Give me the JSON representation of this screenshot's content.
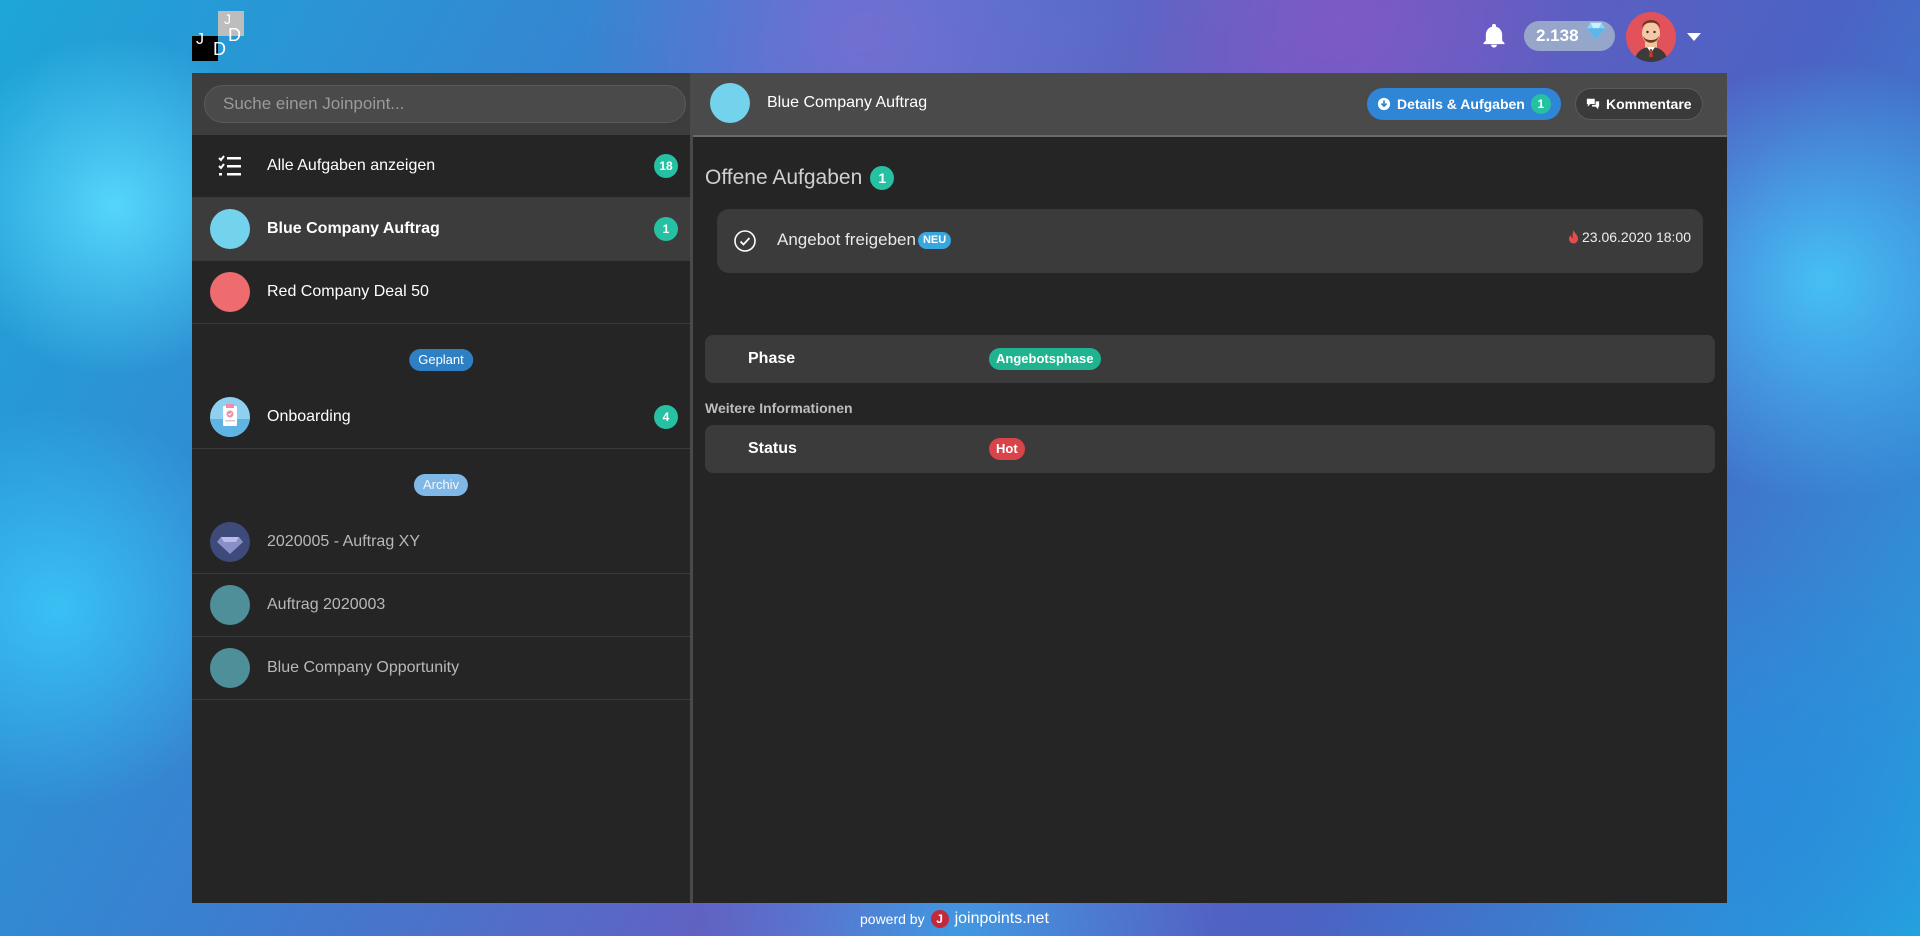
{
  "logo": {
    "letters": [
      "J",
      "D",
      "J",
      "D"
    ]
  },
  "topbar": {
    "points": "2.138",
    "icons": {
      "bell": "bell-icon",
      "points": "diamond-icon",
      "menu": "chevron-down-icon"
    }
  },
  "sidebar": {
    "search_placeholder": "Suche einen Joinpoint...",
    "all_tasks": {
      "label": "Alle Aufgaben anzeigen",
      "count": "18"
    },
    "active": [
      {
        "label": "Blue Company Auftrag",
        "count": "1",
        "color": "#74d3ec"
      },
      {
        "label": "Red Company Deal 50",
        "count": "",
        "color": "#ee6b6f"
      }
    ],
    "planned_label": "Geplant",
    "planned": [
      {
        "label": "Onboarding",
        "count": "4"
      }
    ],
    "archive_label": "Archiv",
    "archived": [
      {
        "label": "2020005 - Auftrag XY",
        "color": "#4a5a8a"
      },
      {
        "label": "Auftrag 2020003",
        "color": "#4f8f99"
      },
      {
        "label": "Blue Company Opportunity",
        "color": "#4f8f99"
      }
    ]
  },
  "content": {
    "title": "Blue Company Auftrag",
    "tabs": {
      "details": "Details & Aufgaben",
      "details_count": "1",
      "comments": "Kommentare"
    },
    "open_tasks_title": "Offene Aufgaben",
    "open_tasks_count": "1",
    "task": {
      "name": "Angebot freigeben",
      "badge": "NEU",
      "due": "23.06.2020 18:00"
    },
    "phase": {
      "key": "Phase",
      "value": "Angebotsphase"
    },
    "more_info_title": "Weitere Informationen",
    "status": {
      "key": "Status",
      "value": "Hot"
    }
  },
  "footer": {
    "powered": "powerd by",
    "site": "joinpoints.net",
    "logo_letter": "J"
  }
}
